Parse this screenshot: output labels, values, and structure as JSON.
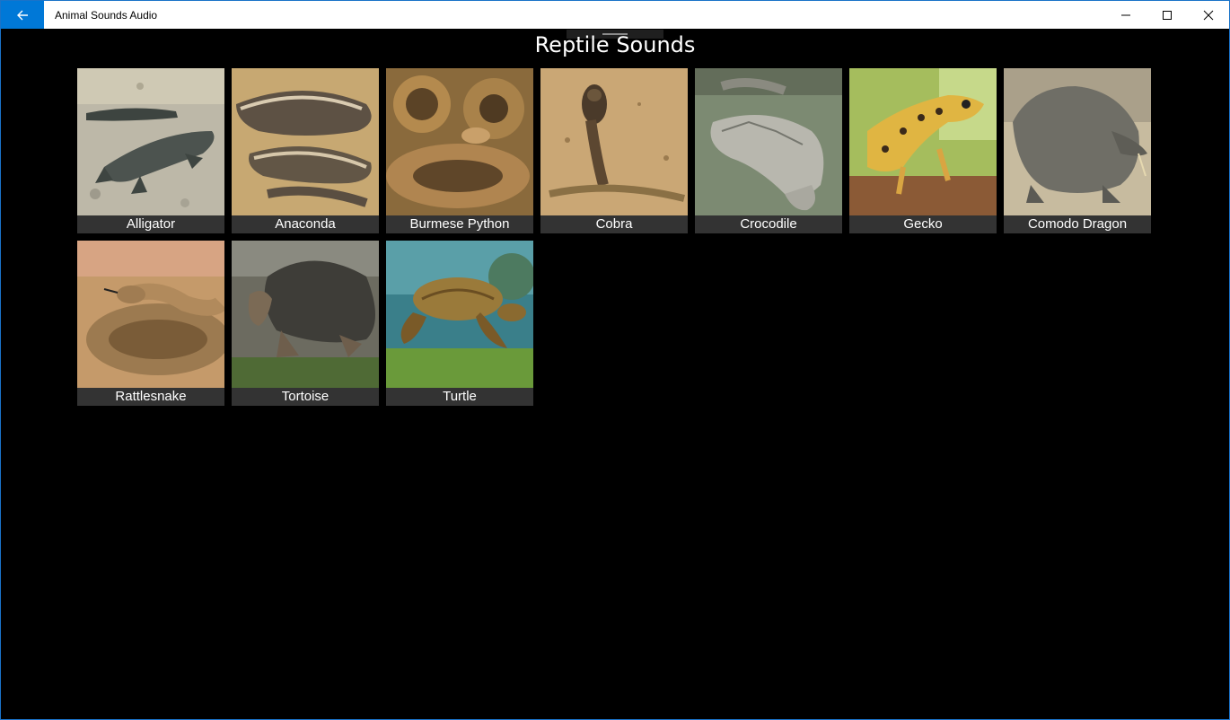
{
  "window": {
    "title": "Animal Sounds Audio",
    "accent_color": "#0078d7"
  },
  "page": {
    "title": "Reptile Sounds"
  },
  "animals": [
    {
      "label": "Alligator",
      "icon": "alligator-image"
    },
    {
      "label": "Anaconda",
      "icon": "anaconda-image"
    },
    {
      "label": "Burmese Python",
      "icon": "burmese-python-image"
    },
    {
      "label": "Cobra",
      "icon": "cobra-image"
    },
    {
      "label": "Crocodile",
      "icon": "crocodile-image"
    },
    {
      "label": "Gecko",
      "icon": "gecko-image"
    },
    {
      "label": "Comodo Dragon",
      "icon": "comodo-dragon-image"
    },
    {
      "label": "Rattlesnake",
      "icon": "rattlesnake-image"
    },
    {
      "label": "Tortoise",
      "icon": "tortoise-image"
    },
    {
      "label": "Turtle",
      "icon": "turtle-image"
    }
  ]
}
